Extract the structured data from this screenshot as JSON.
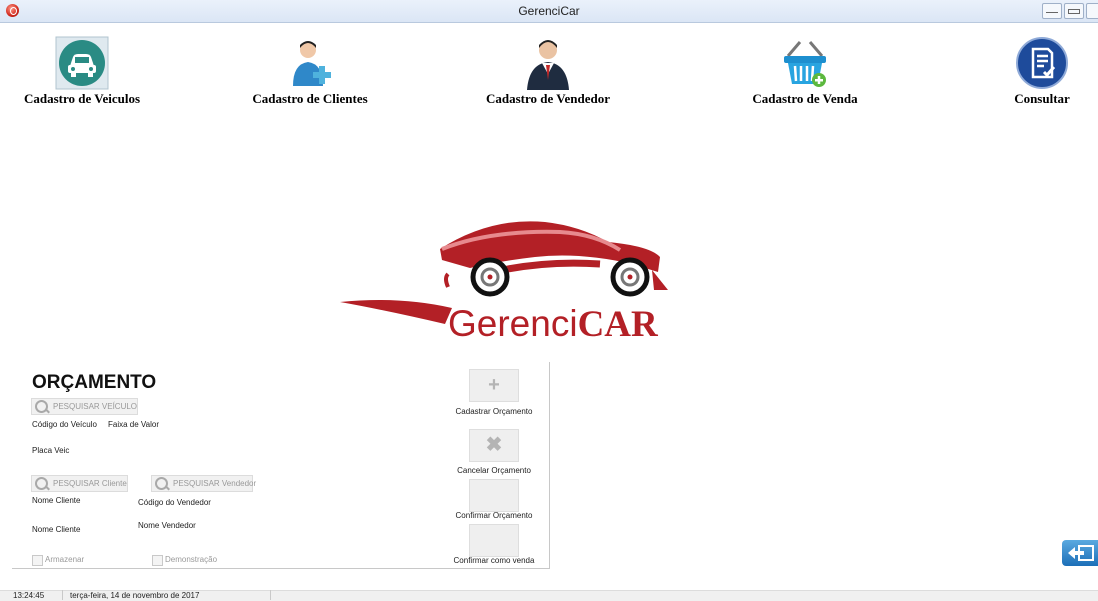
{
  "window": {
    "title": "GerenciCar"
  },
  "toolbar": {
    "items": [
      {
        "label": "Cadastro de Veiculos",
        "icon": "car-icon"
      },
      {
        "label": "Cadastro de Clientes",
        "icon": "add-client-icon"
      },
      {
        "label": "Cadastro de Vendedor",
        "icon": "salesman-icon"
      },
      {
        "label": "Cadastro de Venda",
        "icon": "shopping-basket-icon"
      },
      {
        "label": "Consultar",
        "icon": "document-check-icon"
      }
    ]
  },
  "logo": {
    "text_thin": "Gerenci",
    "text_bold": "CAR"
  },
  "budget": {
    "title": "ORÇAMENTO",
    "search_vehicle": "PESQUISAR VEÍCULO",
    "vehicle_code_label": "Código do Veículo",
    "price_range_label": "Faixa de Valor",
    "plate_label": "Placa Veic",
    "search_client": "PESQUISAR Cliente",
    "search_seller": "PESQUISAR Vendedor",
    "client_name_label": "Nome Cliente",
    "seller_code_label": "Código do Vendedor",
    "client_name_label_2": "Nome Cliente",
    "seller_name_label": "Nome Vendedor",
    "store_checkbox": "Armazenar",
    "demo_checkbox": "Demonstração",
    "actions": [
      {
        "label": "Cadastrar Orçamento",
        "symbol": "+"
      },
      {
        "label": "Cancelar Orçamento",
        "symbol": "✖"
      },
      {
        "label": "Confirmar Orçamento",
        "symbol": ""
      },
      {
        "label": "Confirmar como venda",
        "symbol": ""
      }
    ]
  },
  "status": {
    "time": "13:24:45",
    "date": "terça-feira, 14 de novembro de 2017"
  },
  "colors": {
    "brand": "#b32026",
    "teal": "#2a8b84",
    "navy": "#1e4b9b"
  }
}
